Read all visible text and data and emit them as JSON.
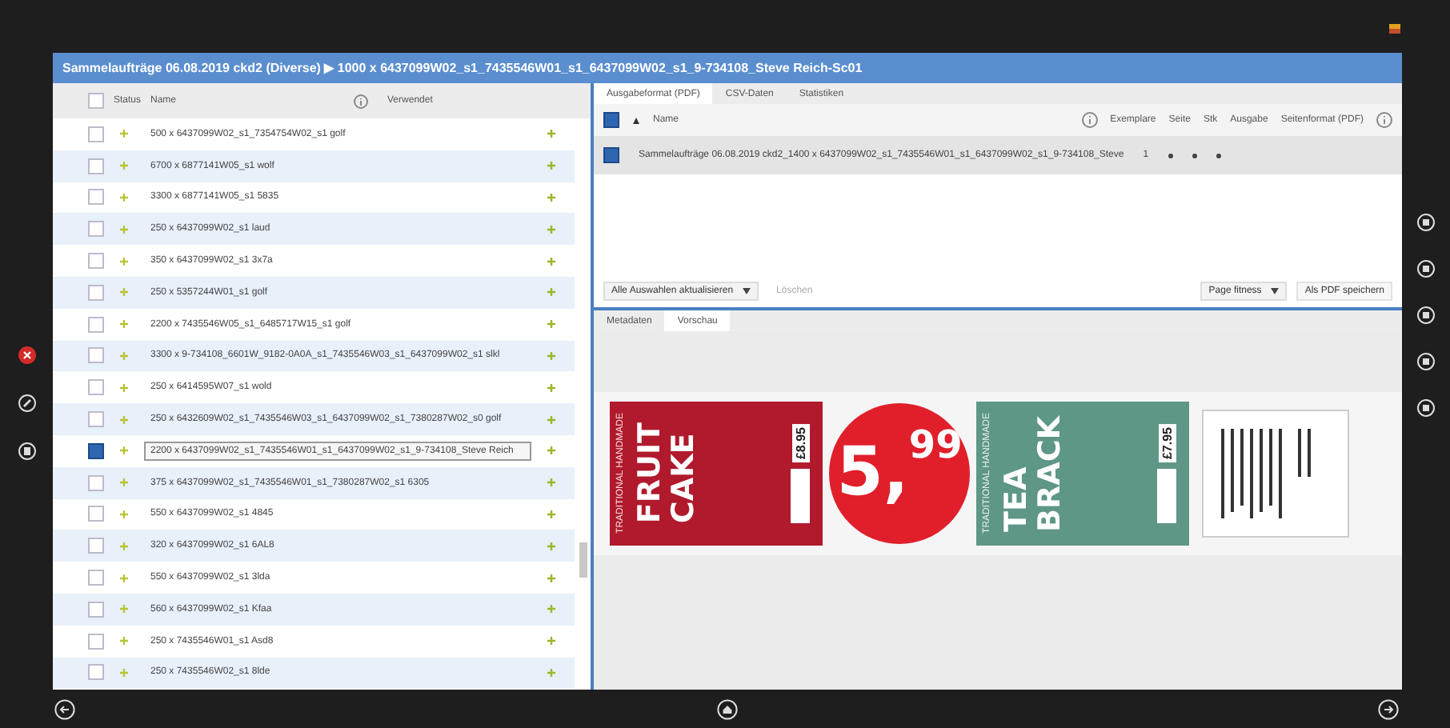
{
  "window": {
    "title": "Sammelaufträge 06.08.2019 ckd2 (Diverse) ▶ 1000 x 6437099W02_s1_7435546W01_s1_6437099W02_s1_9-734108_Steve Reich-Sc01"
  },
  "list": {
    "checked": false,
    "columns": [
      "Status",
      "Name"
    ],
    "column_right": "Verwendet",
    "rows": [
      {
        "name": "500 x 6437099W02_s1_7354754W02_s1 golf",
        "selected": false
      },
      {
        "name": "6700 x 6877141W05_s1 wolf",
        "selected": false
      },
      {
        "name": "3300 x 6877141W05_s1 5835",
        "selected": false
      },
      {
        "name": "250 x 6437099W02_s1 laud",
        "selected": false
      },
      {
        "name": "350 x 6437099W02_s1 3x7a",
        "selected": false
      },
      {
        "name": "250 x 5357244W01_s1 golf",
        "selected": false
      },
      {
        "name": "2200 x 7435546W05_s1_6485717W15_s1 golf",
        "selected": false
      },
      {
        "name": "3300 x 9-734108_6601W_9182-0A0A_s1_7435546W03_s1_6437099W02_s1 slkl",
        "selected": false
      },
      {
        "name": "250 x 6414595W07_s1 wold",
        "selected": false
      },
      {
        "name": "250 x 6432609W02_s1_7435546W03_s1_6437099W02_s1_7380287W02_s0 golf",
        "selected": false
      },
      {
        "name": "2200 x 6437099W02_s1_7435546W01_s1_6437099W02_s1_9-734108_Steve Reich",
        "selected": true
      },
      {
        "name": "375 x 6437099W02_s1_7435546W01_s1_7380287W02_s1 6305",
        "selected": false
      },
      {
        "name": "550 x 6437099W02_s1 4845",
        "selected": false
      },
      {
        "name": "320 x 6437099W02_s1 6AL8",
        "selected": false
      },
      {
        "name": "550 x 6437099W02_s1 3lda",
        "selected": false
      },
      {
        "name": "560 x 6437099W02_s1 Kfaa",
        "selected": false
      },
      {
        "name": "250 x 7435546W01_s1 Asd8",
        "selected": false
      },
      {
        "name": "250 x 7435546W02_s1 8lde",
        "selected": false
      }
    ]
  },
  "output": {
    "tabs": [
      {
        "label": "Ausgabeformat (PDF)",
        "selected": true
      },
      {
        "label": "CSV-Daten",
        "selected": false
      },
      {
        "label": "Statistiken",
        "selected": false
      }
    ],
    "checked": true,
    "sort_label": "Name",
    "columns": [
      "Exemplare",
      "Seite",
      "Stk",
      "Ausgabe",
      "Seitenformat (PDF)"
    ],
    "rows": [
      {
        "name": "Sammelaufträge 06.08.2019 ckd2_1400 x 6437099W02_s1_7435546W01_s1_6437099W02_s1_9-734108_Steve",
        "copies": "1",
        "checked": true
      }
    ],
    "action": "Alle Auswahlen aktualisieren",
    "delete": {
      "label": "Löschen",
      "disabled": true
    },
    "zoom": "Page fitness",
    "save": "Als PDF speichern"
  },
  "preview": {
    "tabs": [
      {
        "label": "Metadaten",
        "selected": false
      },
      {
        "label": "Vorschau",
        "selected": true
      }
    ],
    "labels": [
      {
        "kind": "product",
        "color": "#b01a2c",
        "subtitle": "TRADITIONAL HANDMADE",
        "name": [
          "FRUIT",
          "CAKE"
        ],
        "price": "£8.95"
      },
      {
        "kind": "price_circle",
        "color": "#e01f2b",
        "whole": "5,",
        "cents": "99"
      },
      {
        "kind": "product",
        "color": "#5e9687",
        "subtitle": "TRADITIONAL HANDMADE",
        "name": [
          "TEA",
          "BRACK"
        ],
        "price": "£7.95"
      },
      {
        "kind": "back"
      }
    ]
  }
}
